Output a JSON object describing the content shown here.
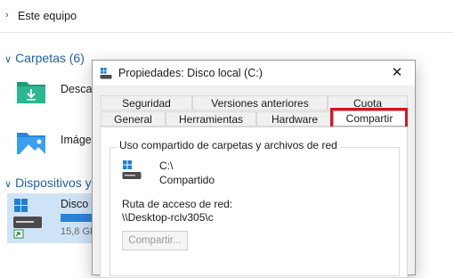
{
  "explorer": {
    "nav_item": "Este equipo",
    "groups": {
      "folders": "Carpetas (6)",
      "devices": "Dispositivos y"
    },
    "items": {
      "downloads": "Descar",
      "images": "Imágen",
      "drive": "Disco l",
      "drive_size": "15,8 GE"
    }
  },
  "dialog": {
    "title": "Propiedades: Disco local (C:)",
    "tabs_row1": [
      "Seguridad",
      "Versiones anteriores",
      "Cuota"
    ],
    "tabs_row2": [
      "General",
      "Herramientas",
      "Hardware",
      "Compartir"
    ],
    "active_tab": "Compartir",
    "group_title": "Uso compartido de carpetas y archivos de red",
    "drive_name": "C:\\",
    "share_status": "Compartido",
    "path_label": "Ruta de acceso de red:",
    "path_value": "\\\\Desktop-rclv305\\c",
    "share_button": "Compartir..."
  },
  "colors": {
    "accent": "#1f5fa8",
    "highlight": "#e01020",
    "selected_row": "#cfe3f6"
  },
  "icons": [
    "chevron-right-icon",
    "chevron-down-icon",
    "downloads-folder-icon",
    "images-folder-icon",
    "drive-icon",
    "close-icon",
    "windows-drive-icon"
  ]
}
